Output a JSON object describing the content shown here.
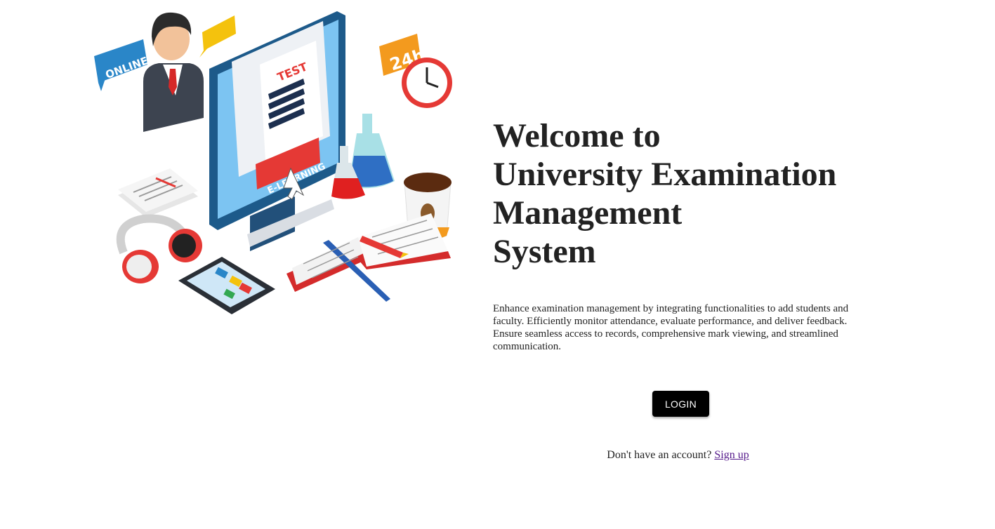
{
  "illustration": {
    "online_bubble": "ONLINE",
    "clock_badge": "24h",
    "test_sheet": "TEST",
    "elearning_banner": "E-LEARNING"
  },
  "hero": {
    "title_lines": [
      "Welcome to",
      "University Examination",
      "Management",
      "System"
    ],
    "description": "Enhance examination management by integrating functionalities to add students and faculty. Efficiently monitor attendance, evaluate performance, and deliver feedback. Ensure seamless access to records, comprehensive mark viewing, and streamlined communication."
  },
  "actions": {
    "login_label": "LOGIN",
    "signup_prompt": "Don't have an account?",
    "signup_link": "Sign up"
  },
  "colors": {
    "button_bg": "#000000",
    "button_text": "#ffffff",
    "link": "#551a8b",
    "text": "#222222"
  }
}
